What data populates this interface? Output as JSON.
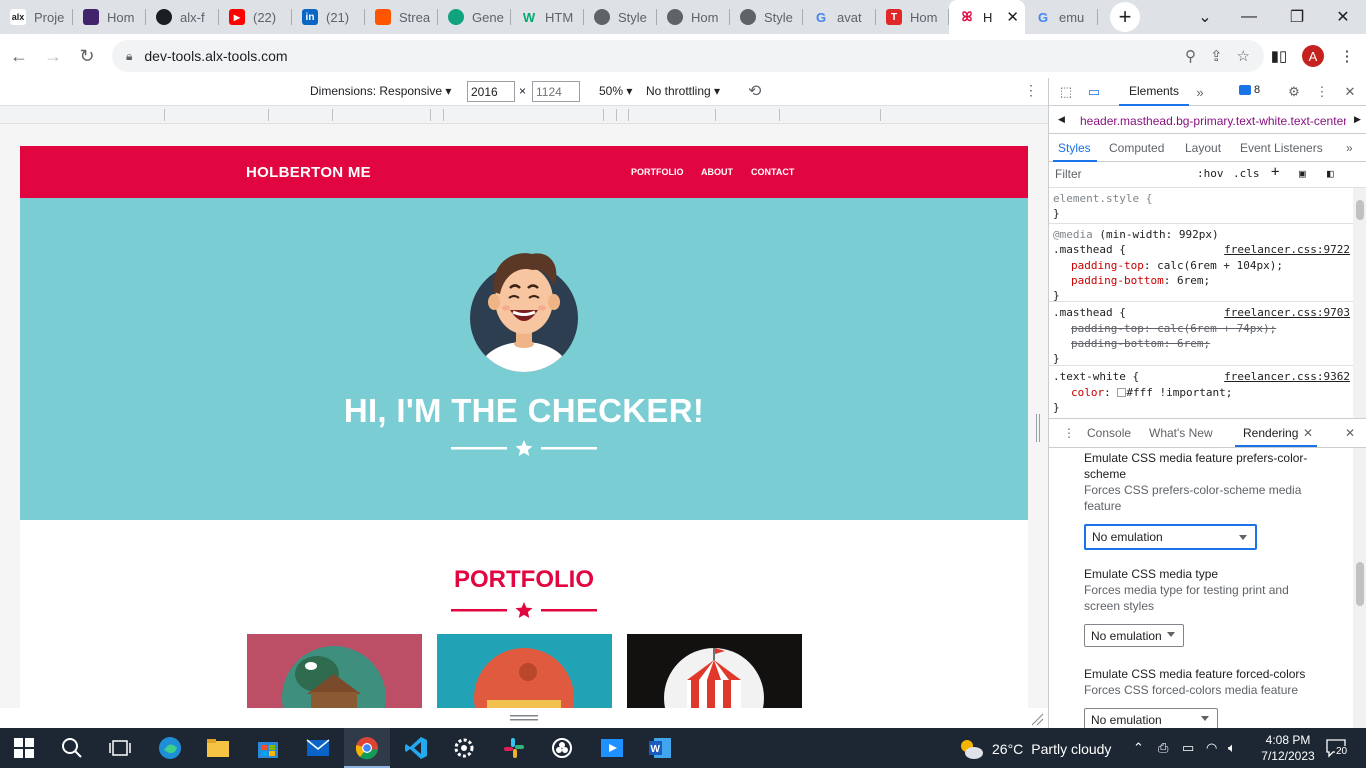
{
  "browser": {
    "tabs": [
      {
        "label": "Proje",
        "icon_text": "alx",
        "color": "#1f1f1f"
      },
      {
        "label": "Hom",
        "icon_text": "",
        "color": "#41246b"
      },
      {
        "label": "alx-f",
        "icon_text": "",
        "color": "#1b1f23"
      },
      {
        "label": "(22)",
        "icon_text": "▶",
        "color": "#ff0000"
      },
      {
        "label": "(21)",
        "icon_text": "in",
        "color": "#0a66c2"
      },
      {
        "label": "Strea",
        "icon_text": "",
        "color": "#ff5500"
      },
      {
        "label": "Gene",
        "icon_text": "",
        "color": "#10a37f"
      },
      {
        "label": "HTM",
        "icon_text": "W",
        "color": "#04aa6d"
      },
      {
        "label": "Style",
        "icon_text": "",
        "color": "#5f6368"
      },
      {
        "label": "Hom",
        "icon_text": "",
        "color": "#5f6368"
      },
      {
        "label": "Style",
        "icon_text": "",
        "color": "#5f6368"
      },
      {
        "label": "avat",
        "icon_text": "G",
        "color": "#4285f4"
      },
      {
        "label": "Hom",
        "icon_text": "T",
        "color": "#e12828"
      },
      {
        "label": "H",
        "icon_text": "",
        "color": "#e20640"
      },
      {
        "label": "emu",
        "icon_text": "G",
        "color": "#4285f4"
      }
    ],
    "url": "dev-tools.alx-tools.com",
    "profile_initial": "A"
  },
  "device_toolbar": {
    "dimensions_label": "Dimensions: Responsive",
    "width": "2016",
    "height_placeholder": "1124",
    "times": "×",
    "zoom": "50%",
    "throttling": "No throttling"
  },
  "site": {
    "brand": "HOLBERTON ME",
    "nav": [
      "PORTFOLIO",
      "ABOUT",
      "CONTACT"
    ],
    "hero_title": "HI, I'M THE CHECKER!",
    "section_title": "PORTFOLIO",
    "colors": {
      "primary": "#e20640",
      "hero_bg": "#79cdd3"
    }
  },
  "devtools": {
    "main_tab": "Elements",
    "issues_count": "8",
    "breadcrumb": "header.masthead.bg-primary.text-white.text-center",
    "sub_tabs": [
      "Styles",
      "Computed",
      "Layout",
      "Event Listeners"
    ],
    "filter_placeholder": "Filter",
    "hov": ":hov",
    "cls": ".cls",
    "styles": {
      "element_style": "element.style {",
      "close": "}",
      "media": "@media",
      "media_query": "(min-width: 992px)",
      "rule1_selector": ".masthead {",
      "rule1_source": "freelancer.css:9722",
      "rule1_p1_name": "padding-top",
      "rule1_p1_value": "calc(6rem + 104px);",
      "rule1_p2_name": "padding-bottom",
      "rule1_p2_value": "6rem;",
      "rule2_selector": ".masthead {",
      "rule2_source": "freelancer.css:9703",
      "rule2_p1": "padding-top: calc(6rem + 74px);",
      "rule2_p2": "padding-bottom: 6rem;",
      "rule3_selector": ".text-white {",
      "rule3_source": "freelancer.css:9362",
      "rule3_p1_name": "color",
      "rule3_p1_value": "#fff !important;"
    },
    "drawer_tabs": [
      "Console",
      "What's New",
      "Rendering"
    ],
    "rendering": {
      "item1_title": "Emulate CSS media feature prefers-color-scheme",
      "item1_desc": "Forces CSS prefers-color-scheme media feature",
      "item1_value": "No emulation",
      "item2_title": "Emulate CSS media type",
      "item2_desc": "Forces media type for testing print and screen styles",
      "item2_value": "No emulation",
      "item3_title": "Emulate CSS media feature forced-colors",
      "item3_desc": "Forces CSS forced-colors media feature",
      "item3_value": "No emulation"
    }
  },
  "taskbar": {
    "temperature": "26°C",
    "weather": "Partly cloudy",
    "time": "4:08 PM",
    "date": "7/12/2023",
    "notifications": "20"
  }
}
